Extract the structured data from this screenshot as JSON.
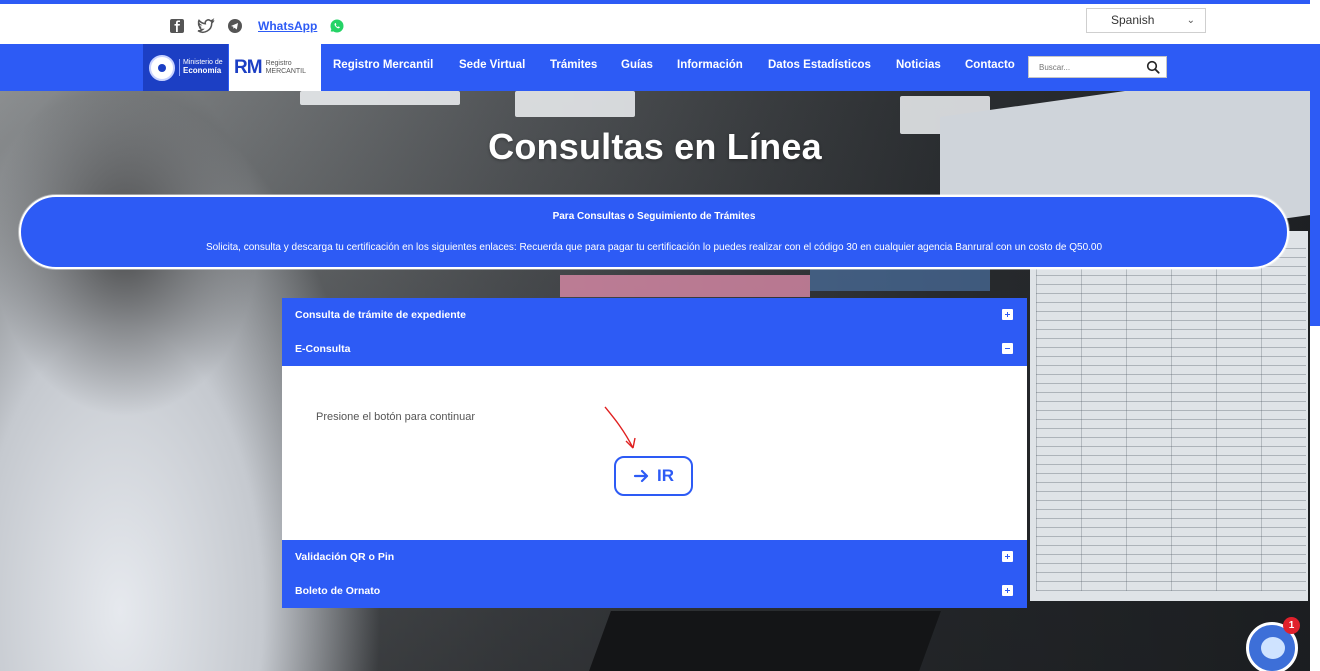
{
  "colors": {
    "primary": "#2d5bf5",
    "banner_border": "#ffffff",
    "whatsapp_green": "#25d366",
    "badge_red": "#e0202c"
  },
  "topbar": {
    "social_icons": [
      "facebook-icon",
      "twitter-icon",
      "telegram-icon",
      "whatsapp-icon"
    ],
    "whatsapp_label": "WhatsApp",
    "language": "Spanish"
  },
  "logos": {
    "ministry_line1": "Ministerio de",
    "ministry_line2": "Economía",
    "rm_mark": "RM",
    "rm_line1": "Registro",
    "rm_line2": "MERCANTIL"
  },
  "nav": {
    "items": [
      "Registro Mercantil",
      "Sede Virtual",
      "Trámites",
      "Guías",
      "Información",
      "Datos Estadísticos",
      "Noticias",
      "Contacto"
    ],
    "search_placeholder": "Buscar..."
  },
  "hero": {
    "title": "Consultas en Línea"
  },
  "info_banner": {
    "title": "Para Consultas o Seguimiento de Trámites",
    "text": "Solicita, consulta y descarga tu certificación en los siguientes enlaces: Recuerda que para pagar tu certificación lo puedes realizar con el código 30 en cualquier agencia Banrural con un costo de Q50.00"
  },
  "accordion": {
    "sections": [
      {
        "label": "Consulta de trámite de expediente",
        "open": false
      },
      {
        "label": "E-Consulta",
        "open": true
      },
      {
        "label": "Validación QR o Pin",
        "open": false
      },
      {
        "label": "Boleto de Ornato",
        "open": false
      }
    ],
    "econsulta": {
      "hint": "Presione el botón para continuar",
      "button_label": "IR"
    }
  },
  "chat": {
    "badge_count": "1"
  }
}
